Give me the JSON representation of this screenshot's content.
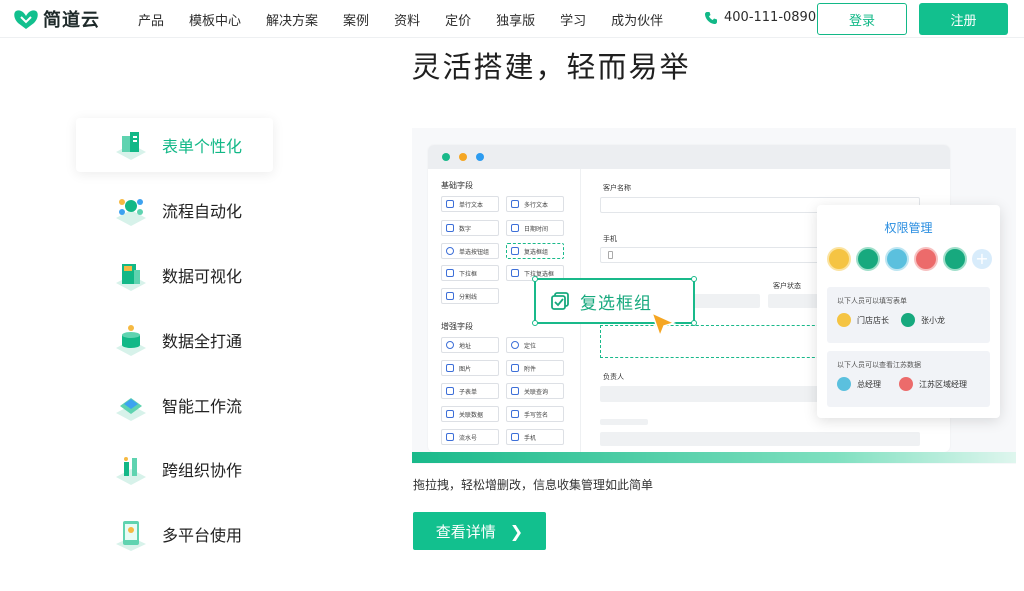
{
  "nav": {
    "brand": "简道云",
    "menu": [
      "产品",
      "模板中心",
      "解决方案",
      "案例",
      "资料",
      "定价",
      "独享版",
      "学习",
      "成为伙伴"
    ],
    "phone": "400-111-0890",
    "login": "登录",
    "register": "注册"
  },
  "headline": "灵活搭建，轻而易举",
  "sidebar": [
    {
      "label": "表单个性化",
      "icon": "form-icon",
      "active": true
    },
    {
      "label": "流程自动化",
      "icon": "workflow-icon"
    },
    {
      "label": "数据可视化",
      "icon": "chart-icon"
    },
    {
      "label": "数据全打通",
      "icon": "database-icon"
    },
    {
      "label": "智能工作流",
      "icon": "smart-flow-icon"
    },
    {
      "label": "跨组织协作",
      "icon": "collaboration-icon"
    },
    {
      "label": "多平台使用",
      "icon": "multi-platform-icon"
    }
  ],
  "mock": {
    "basic_title": "基础字段",
    "basic_fields": [
      "单行文本",
      "多行文本",
      "数字",
      "日期时间",
      "单选按钮组",
      "复选框组",
      "下拉框",
      "下拉复选框",
      "分割线"
    ],
    "advanced_title": "增强字段",
    "advanced_fields": [
      "地址",
      "定位",
      "图片",
      "附件",
      "子表单",
      "关联查询",
      "关联数据",
      "手写签名",
      "流水号",
      "手机"
    ],
    "form_label_customer": "客户名称",
    "form_label_phone": "手机",
    "form_label_status": "客户状态",
    "form_label_owner": "负责人",
    "drag_label": "复选框组"
  },
  "permission": {
    "title": "权限管理",
    "box1_text": "以下人员可以填写表单",
    "box1_people": [
      "门店店长",
      "张小龙"
    ],
    "box2_text": "以下人员可以查看江苏数据",
    "box2_people": [
      "总经理",
      "江苏区域经理"
    ]
  },
  "caption": "拖拉拽，轻松增删改，信息收集管理如此简单",
  "detail_button": "查看详情",
  "colors": {
    "accent": "#12c08e",
    "dot_red": "#19b98a",
    "dot_yellow": "#f5a623",
    "dot_blue": "#2d9cf0",
    "perm_title": "#2a8ee0"
  }
}
